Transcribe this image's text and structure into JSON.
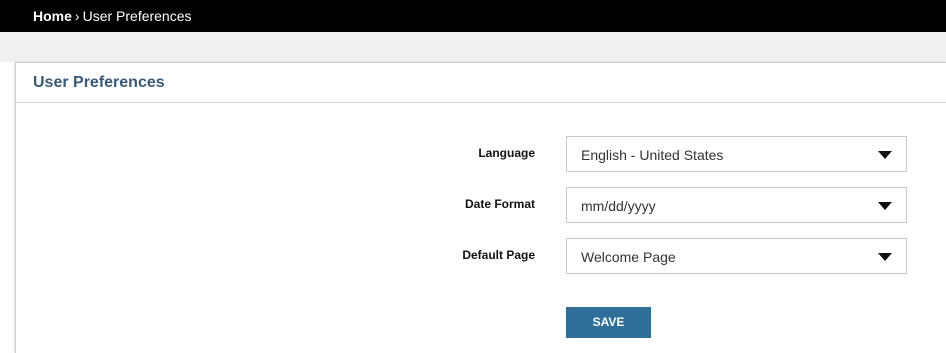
{
  "breadcrumb": {
    "home": "Home",
    "separator": "›",
    "current": "User Preferences"
  },
  "panel": {
    "title": "User Preferences"
  },
  "form": {
    "language": {
      "label": "Language",
      "value": "English - United States",
      "icon": "caret-down-icon"
    },
    "date_format": {
      "label": "Date Format",
      "value": "mm/dd/yyyy",
      "icon": "caret-down-icon"
    },
    "default_page": {
      "label": "Default Page",
      "value": "Welcome Page",
      "icon": "caret-down-icon"
    },
    "save_label": "SAVE"
  },
  "colors": {
    "topbar": "#000000",
    "title": "#3b5a78",
    "save_button": "#2f6f99"
  }
}
